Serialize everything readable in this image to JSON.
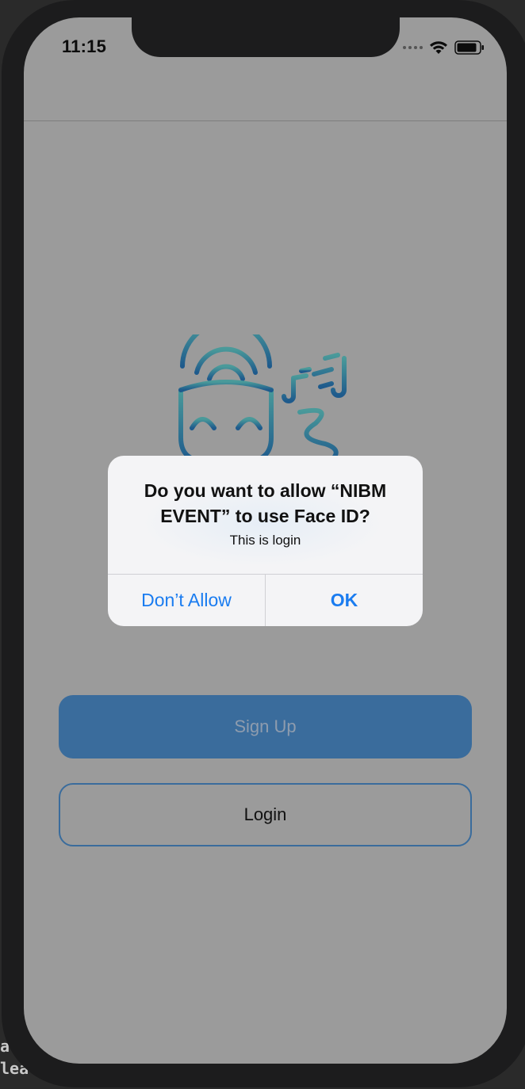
{
  "status_bar": {
    "time": "11:15",
    "wifi_icon": "wifi-icon",
    "battery_icon": "battery-icon"
  },
  "logo": {
    "icon": "theater-mask-music-icon",
    "gradient_top": "#4a9a9a",
    "gradient_bottom": "#1e5a8c"
  },
  "alert": {
    "title": "Do you want to allow “NIBM EVENT” to use Face ID?",
    "message": "This is login",
    "dont_allow_label": "Don’t Allow",
    "ok_label": "OK"
  },
  "buttons": {
    "signup_label": "Sign Up",
    "login_label": "Login"
  },
  "backdrop": {
    "fragment_1": "a",
    "fragment_2": "lea"
  },
  "colors": {
    "accent": "#3a6c9c",
    "alert_button": "#1a7cf0",
    "dim_overlay": "#9b9b9b"
  }
}
